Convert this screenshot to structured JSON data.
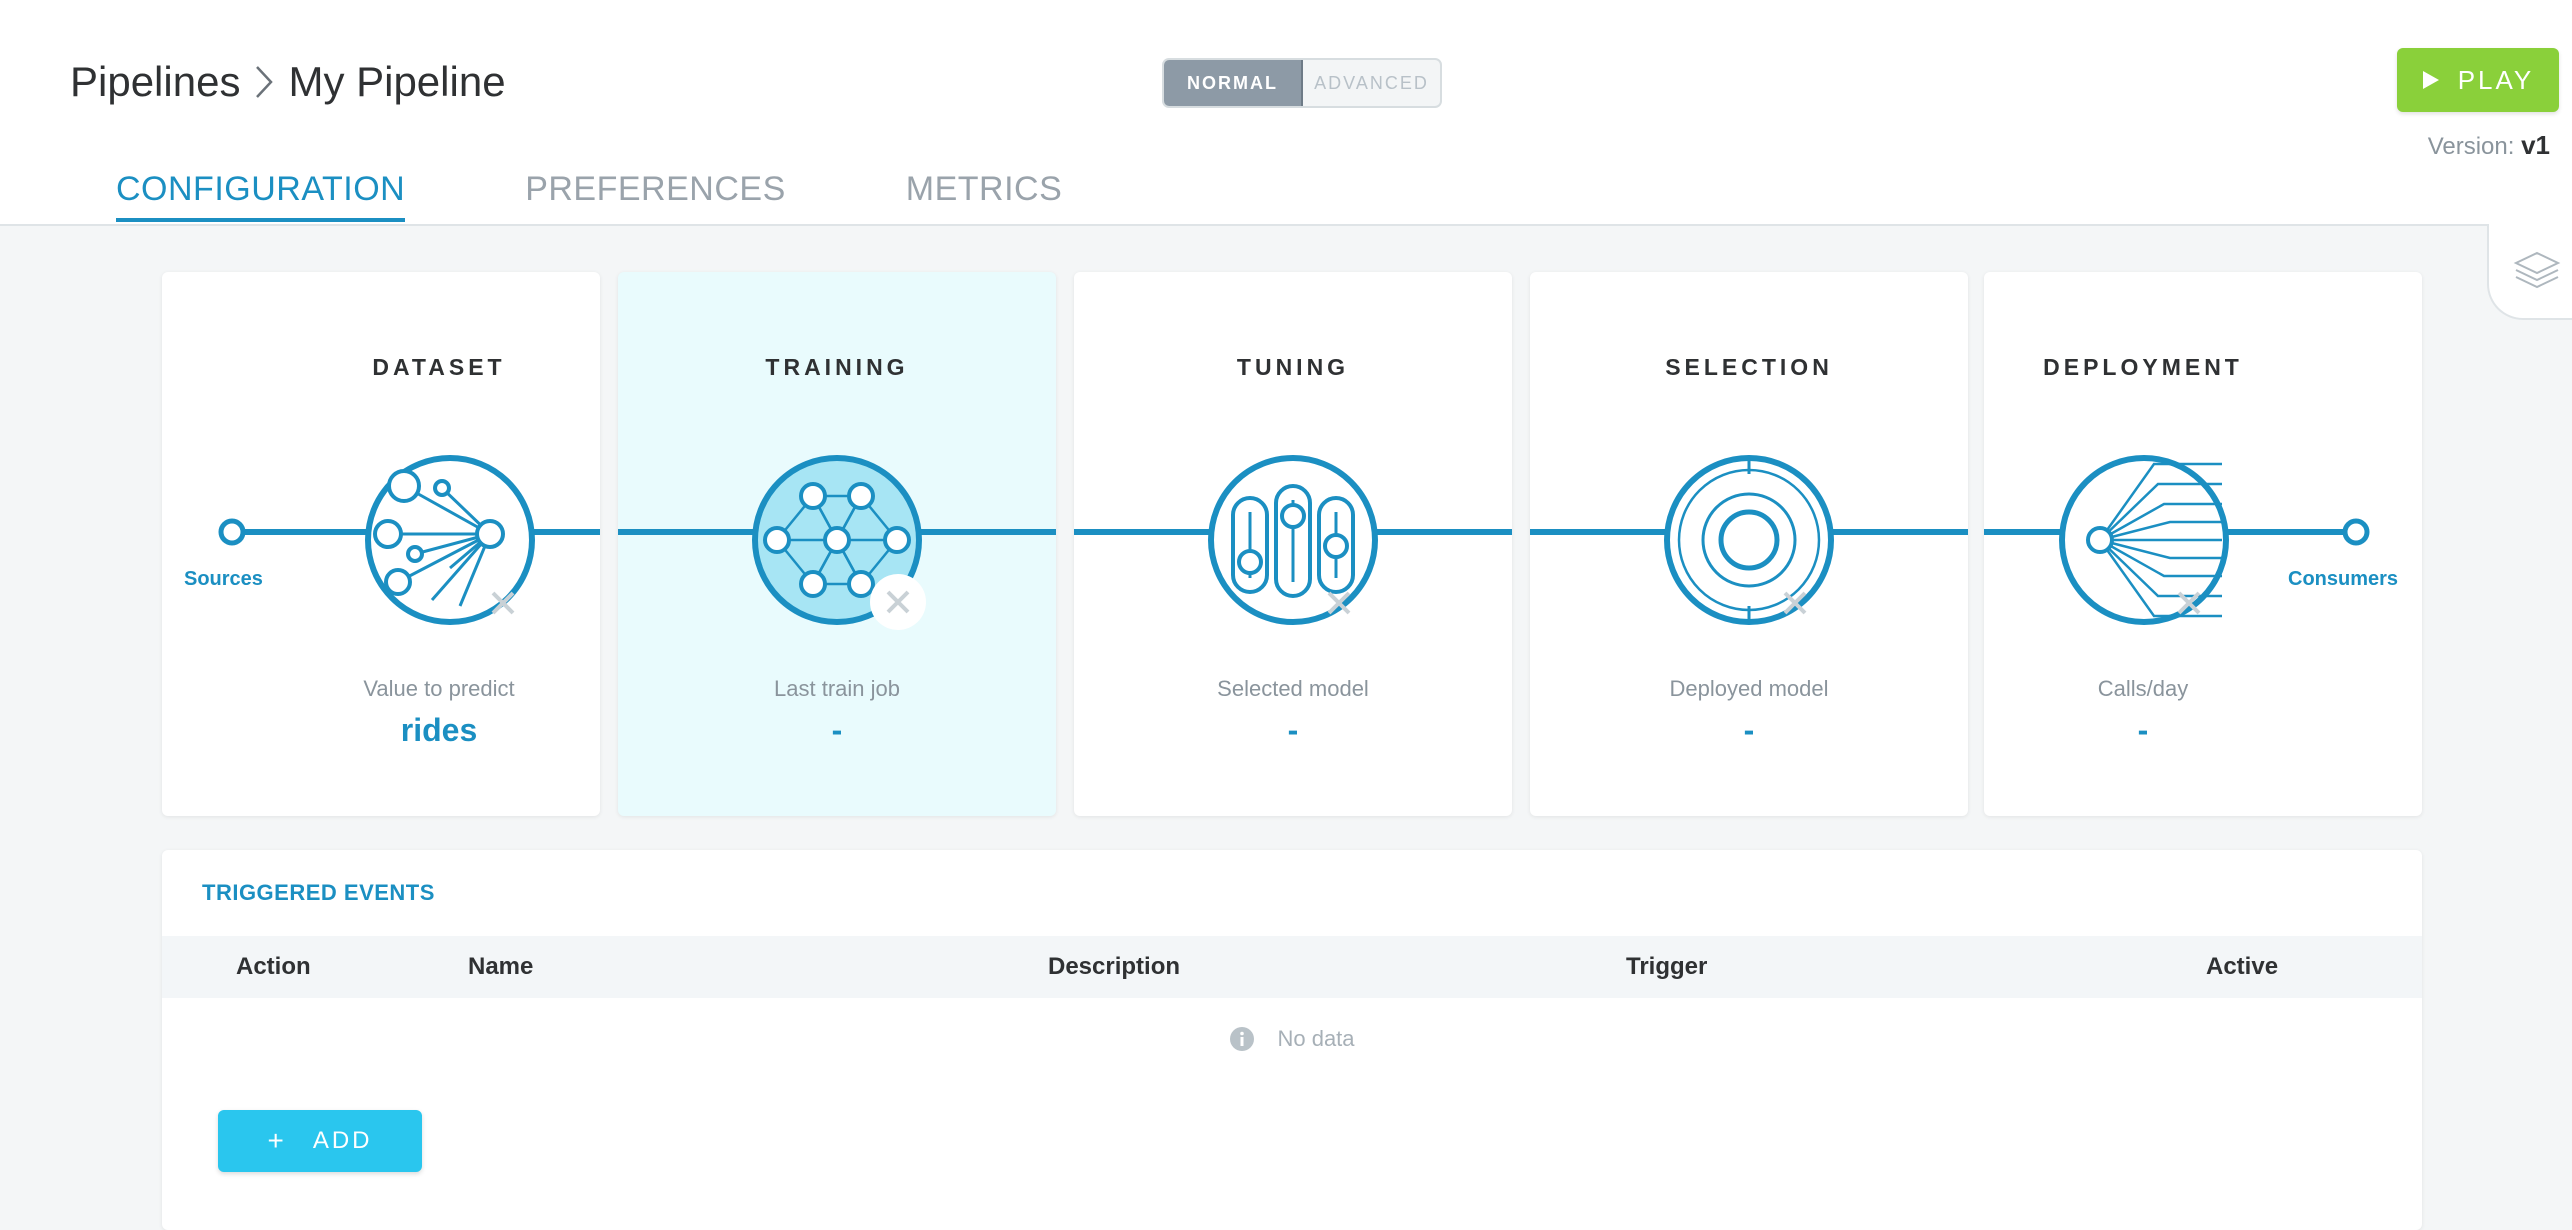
{
  "breadcrumb": {
    "root": "Pipelines",
    "current": "My Pipeline"
  },
  "mode_toggle": {
    "normal": "NORMAL",
    "advanced": "ADVANCED",
    "selected": "NORMAL"
  },
  "play_button": {
    "label": "PLAY"
  },
  "version": {
    "label": "Version:",
    "value": "v1"
  },
  "tabs": [
    {
      "label": "CONFIGURATION",
      "active": true
    },
    {
      "label": "PREFERENCES",
      "active": false
    },
    {
      "label": "METRICS",
      "active": false
    }
  ],
  "stages": [
    {
      "title": "DATASET",
      "label": "Value to predict",
      "value": "rides",
      "icon": "dataset-icon"
    },
    {
      "title": "TRAINING",
      "label": "Last train job",
      "value": "-",
      "icon": "neural-network-icon"
    },
    {
      "title": "TUNING",
      "label": "Selected model",
      "value": "-",
      "icon": "sliders-icon"
    },
    {
      "title": "SELECTION",
      "label": "Deployed model",
      "value": "-",
      "icon": "target-icon"
    },
    {
      "title": "DEPLOYMENT",
      "label": "Calls/day",
      "value": "-",
      "icon": "fan-out-icon"
    }
  ],
  "nodes": {
    "sources": "Sources",
    "consumers": "Consumers"
  },
  "events": {
    "title": "TRIGGERED EVENTS",
    "columns": [
      "Action",
      "Name",
      "Description",
      "Trigger",
      "Active"
    ],
    "rows": [],
    "empty_text": "No data",
    "add_label": "ADD"
  },
  "colors": {
    "accent": "#1b8fc2",
    "play": "#8ad03a",
    "add": "#2ac6ee",
    "selected_card": "#e9fbfd"
  }
}
